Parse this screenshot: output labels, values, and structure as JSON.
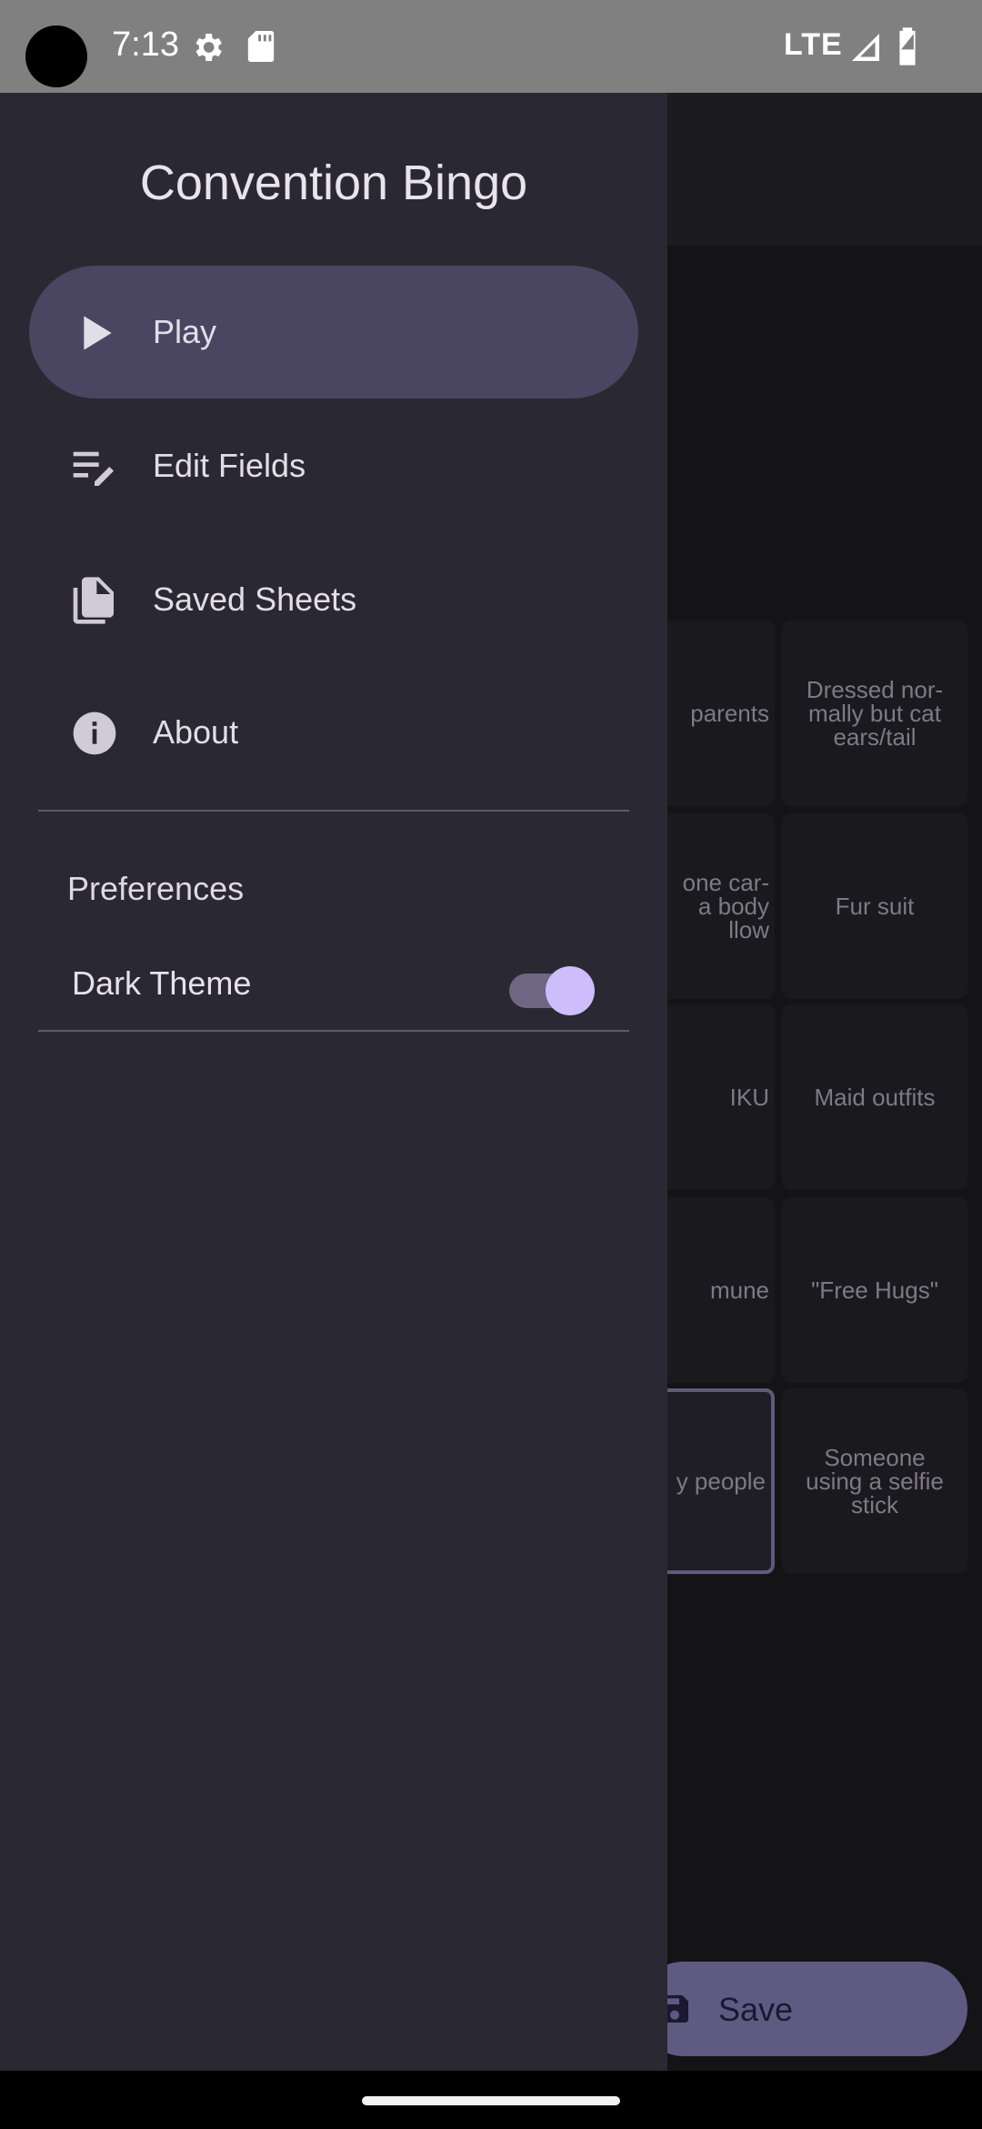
{
  "status_bar": {
    "time": "7:13",
    "network": "LTE"
  },
  "background_app": {
    "cells": [
      "parents",
      "Dressed nor-\nmally but cat\nears/tail",
      "one car-\n a body\nllow",
      "Fur suit",
      "IKU",
      "Maid outfits",
      "mune",
      "\"Free Hugs\"",
      "y people",
      "Someone\nusing a selfie\nstick"
    ],
    "save_label": "Save"
  },
  "drawer": {
    "title": "Convention Bingo",
    "items": [
      {
        "label": "Play",
        "icon": "play-icon",
        "active": true
      },
      {
        "label": "Edit Fields",
        "icon": "edit-list-icon",
        "active": false
      },
      {
        "label": "Saved Sheets",
        "icon": "documents-icon",
        "active": false
      },
      {
        "label": "About",
        "icon": "info-icon",
        "active": false
      }
    ],
    "preferences": {
      "header": "Preferences",
      "dark_theme": {
        "label": "Dark Theme",
        "on": true
      }
    }
  },
  "colors": {
    "drawer_bg": "#2a2832",
    "active_item_bg": "#4a4560",
    "switch_thumb": "#cdbdfa",
    "fab_bg": "#5f5a82"
  }
}
